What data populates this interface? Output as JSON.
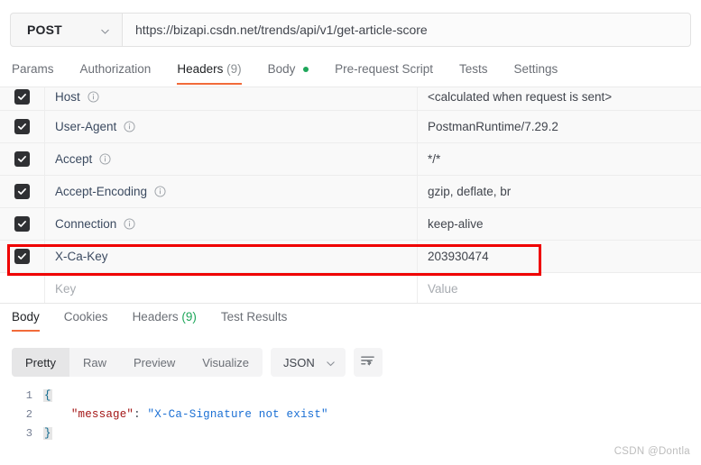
{
  "request": {
    "method": "POST",
    "url": "https://bizapi.csdn.net/trends/api/v1/get-article-score",
    "tabs": [
      {
        "label": "Params",
        "active": false
      },
      {
        "label": "Authorization",
        "active": false
      },
      {
        "label": "Headers",
        "count": "(9)",
        "active": true
      },
      {
        "label": "Body",
        "dot": true,
        "active": false
      },
      {
        "label": "Pre-request Script",
        "active": false
      },
      {
        "label": "Tests",
        "active": false
      },
      {
        "label": "Settings",
        "active": false
      }
    ]
  },
  "headers_table": {
    "key_placeholder": "Key",
    "value_placeholder": "Value",
    "rows": [
      {
        "checked": true,
        "key": "Host",
        "info": true,
        "value": "<calculated when request is sent>"
      },
      {
        "checked": true,
        "key": "User-Agent",
        "info": true,
        "value": "PostmanRuntime/7.29.2"
      },
      {
        "checked": true,
        "key": "Accept",
        "info": true,
        "value": "*/*"
      },
      {
        "checked": true,
        "key": "Accept-Encoding",
        "info": true,
        "value": "gzip, deflate, br"
      },
      {
        "checked": true,
        "key": "Connection",
        "info": true,
        "value": "keep-alive"
      },
      {
        "checked": true,
        "key": "X-Ca-Key",
        "info": false,
        "value": "203930474",
        "highlighted": true
      }
    ]
  },
  "response": {
    "tabs": [
      {
        "label": "Body",
        "active": true
      },
      {
        "label": "Cookies",
        "active": false
      },
      {
        "label": "Headers",
        "count": "(9)",
        "active": false
      },
      {
        "label": "Test Results",
        "active": false
      }
    ],
    "view_modes": [
      {
        "label": "Pretty",
        "active": true
      },
      {
        "label": "Raw",
        "active": false
      },
      {
        "label": "Preview",
        "active": false
      },
      {
        "label": "Visualize",
        "active": false
      }
    ],
    "format": "JSON",
    "body_lines": [
      {
        "num": "1",
        "open_brace": "{"
      },
      {
        "num": "2",
        "indent": "    ",
        "key": "\"message\"",
        "punct": ": ",
        "string": "\"X-Ca-Signature not exist\""
      },
      {
        "num": "3",
        "close_brace": "}"
      }
    ]
  },
  "annotation": {
    "accent_color": "#ef0000"
  },
  "watermark": "CSDN @Dontla",
  "colors": {
    "accent_orange": "#f26b3a",
    "green": "#1ea65a",
    "red_box": "#ef0000"
  }
}
